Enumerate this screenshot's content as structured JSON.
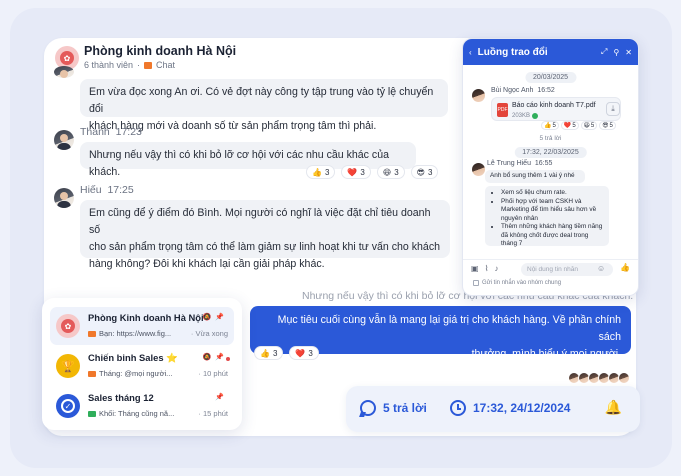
{
  "chat": {
    "title": "Phòng kinh doanh Hà Nội",
    "members": "6 thành viên",
    "channel": "Chat",
    "messages": [
      {
        "text_line1": "Em vừa đọc xong An ơi. Có vẻ đợt này công ty tập trung vào tỷ lệ chuyển đổi",
        "text_line2": "khách hàng mới và doanh số từ sản phẩm trọng tâm thì phải."
      },
      {
        "sender": "Thanh",
        "time": "17:23",
        "text": "Nhưng nếu vậy thì có khi bỏ lỡ cơ hội với các nhu cầu khác của khách."
      },
      {
        "sender": "Hiếu",
        "time": "17:25",
        "text_line1": "Em cũng để ý điểm đó Bình. Mọi người có nghĩ là việc đặt chỉ tiêu doanh số",
        "text_line2": "cho sản phẩm trọng tâm có thể làm giảm sự linh hoạt khi tư vấn cho khách",
        "text_line3": "hàng không? Đôi khi khách lại cần giải pháp khác."
      }
    ],
    "reactions_thanh": [
      {
        "emoji": "👍",
        "count": "3"
      },
      {
        "emoji": "❤️",
        "count": "3"
      },
      {
        "emoji": "😆",
        "count": "3"
      },
      {
        "emoji": "😎",
        "count": "3"
      }
    ],
    "quoted": "Nhưng nếu vậy thì có khi bỏ lỡ cơ hội với các nhu cầu khác của khách.",
    "mine_line1": "Mục tiêu cuối cùng vẫn là mang lại giá trị cho khách hàng. Về phần chính sách",
    "mine_line2": "thưởng, mình hiểu ý mọi người.",
    "reactions_mine": [
      {
        "emoji": "👍",
        "count": "3"
      },
      {
        "emoji": "❤️",
        "count": "3"
      }
    ]
  },
  "thread": {
    "title": "Luồng trao đổi",
    "date1": "20/03/2025",
    "author1": "Bùi Ngọc Anh",
    "time1": "16:52",
    "file_name": "Báo cáo kinh doanh T7.pdf",
    "file_size": "203KB",
    "file_type": "PDF",
    "t_reacts": [
      {
        "emoji": "👍",
        "count": "5"
      },
      {
        "emoji": "❤️",
        "count": "5"
      },
      {
        "emoji": "😆",
        "count": "5"
      },
      {
        "emoji": "😎",
        "count": "5"
      }
    ],
    "replies": "5 trả lời",
    "date2": "17:32, 22/03/2025",
    "author2": "Lê Trung Hiếu",
    "time2": "16:55",
    "reply_intro": "Anh bổ sung thêm 1 vài ý nhé",
    "bullets": [
      "Xem số liệu churn rate.",
      "Phối hợp với team CSKH và Marketing để tìm hiểu sâu hơn về nguyên nhân",
      "Thêm những khách hàng tiềm năng đã không chốt được deal trong tháng 7"
    ],
    "input_placeholder": "Nội dung tin nhắn",
    "send_to_channel": "Gửi tin nhắn vào nhóm chung"
  },
  "conversations": [
    {
      "title": "Phòng Kinh doanh Hà Nội",
      "preview": "Bạn: https://www.fig...",
      "time": "Vừa xong",
      "tag_color": "#f0782b",
      "avatar_color": "#f6c8c8"
    },
    {
      "title": "Chiến binh Sales ⭐",
      "preview": "Tháng: @mọi người...",
      "time": "10 phút",
      "tag_color": "#f0782b",
      "avatar_color": "#f2b705"
    },
    {
      "title": "Sales tháng 12",
      "preview": "Khối: Tháng cũng nă...",
      "time": "15 phút",
      "tag_color": "#2fae5b",
      "avatar_color": "#2b59d8"
    }
  ],
  "summary": {
    "replies": "5 trả lời",
    "timestamp": "17:32, 24/12/2024"
  },
  "colors": {
    "accent": "#2b59d8",
    "channel_tag": "#f0782b"
  }
}
